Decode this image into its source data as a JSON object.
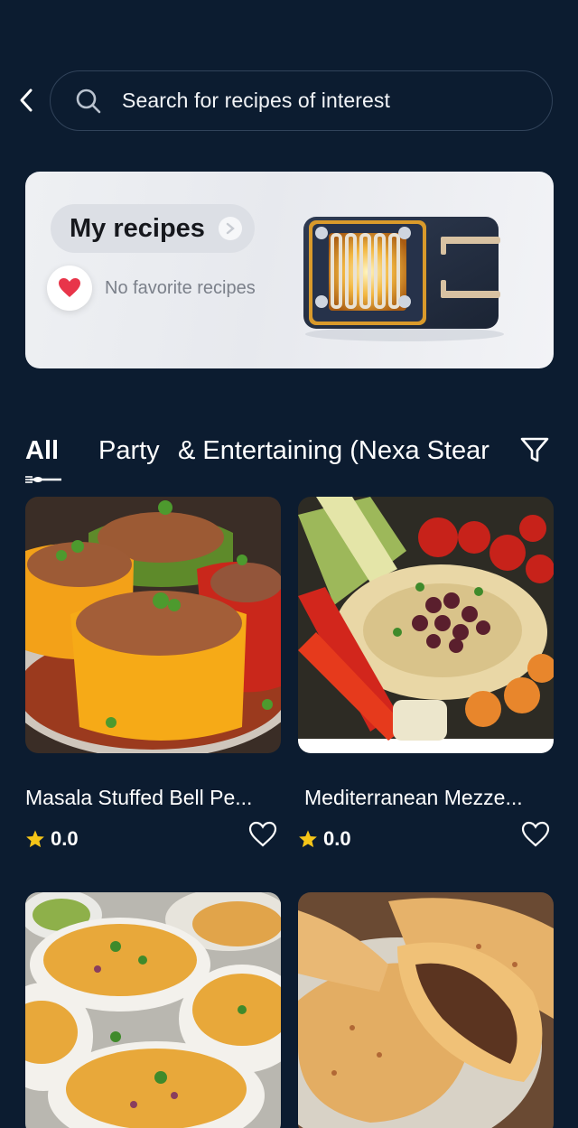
{
  "search": {
    "placeholder": "Search for recipes of interest"
  },
  "banner": {
    "title": "My recipes",
    "favorites_text": "No favorite recipes"
  },
  "tabs": {
    "active": "All",
    "items": [
      "All",
      "Party",
      "& Entertaining (Nexa Stear"
    ]
  },
  "recipes": [
    {
      "title": "Masala Stuffed Bell Pe...",
      "rating": "0.0"
    },
    {
      "title": "Mediterranean Mezze...",
      "rating": "0.0"
    },
    {
      "title": "",
      "rating": ""
    },
    {
      "title": "",
      "rating": ""
    }
  ],
  "colors": {
    "background": "#0c1c30",
    "banner_bg": "#eef0f3",
    "star": "#f5c518",
    "heart": "#e8354a"
  },
  "icons": [
    "back-arrow-icon",
    "search-icon",
    "chevron-right-icon",
    "heart-icon",
    "filter-icon",
    "star-icon",
    "heart-outline-icon",
    "fork-knife-icon"
  ]
}
